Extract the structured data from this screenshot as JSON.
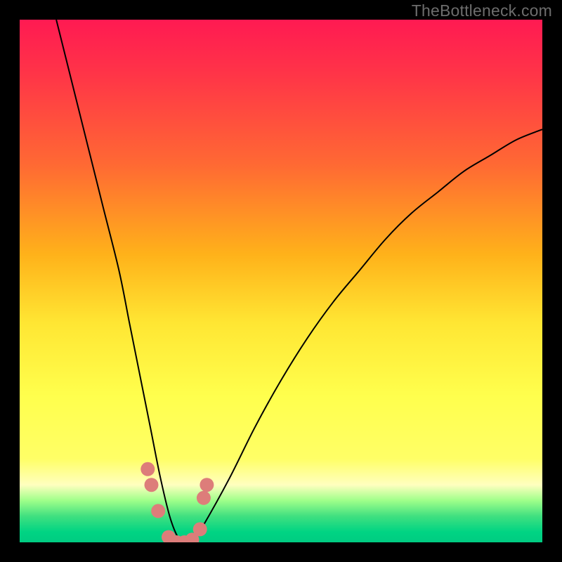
{
  "watermark": "TheBottleneck.com",
  "chart_data": {
    "type": "line",
    "title": "",
    "xlabel": "",
    "ylabel": "",
    "xlim": [
      0,
      100
    ],
    "ylim": [
      0,
      100
    ],
    "grid": false,
    "legend": false,
    "background_gradient": {
      "direction": "vertical",
      "stops": [
        {
          "pos": 0.0,
          "color": "#ff1a52"
        },
        {
          "pos": 0.1,
          "color": "#ff3348"
        },
        {
          "pos": 0.28,
          "color": "#ff6a33"
        },
        {
          "pos": 0.45,
          "color": "#ffb21a"
        },
        {
          "pos": 0.58,
          "color": "#ffe633"
        },
        {
          "pos": 0.72,
          "color": "#ffff4d"
        },
        {
          "pos": 0.84,
          "color": "#ffff66"
        },
        {
          "pos": 0.89,
          "color": "#ffffbf"
        },
        {
          "pos": 0.92,
          "color": "#9fff8a"
        },
        {
          "pos": 0.95,
          "color": "#40e080"
        },
        {
          "pos": 0.98,
          "color": "#00d483"
        },
        {
          "pos": 1.0,
          "color": "#00cc82"
        }
      ]
    },
    "series": [
      {
        "name": "bottleneck-curve",
        "color": "#000000",
        "x": [
          7,
          10,
          13,
          16,
          19,
          21,
          23,
          25,
          27,
          29,
          31,
          33,
          35,
          40,
          45,
          50,
          55,
          60,
          65,
          70,
          75,
          80,
          85,
          90,
          95,
          100
        ],
        "y": [
          100,
          88,
          76,
          64,
          52,
          42,
          32,
          22,
          12,
          4,
          0,
          0,
          3,
          12,
          22,
          31,
          39,
          46,
          52,
          58,
          63,
          67,
          71,
          74,
          77,
          79
        ]
      }
    ],
    "markers": [
      {
        "name": "pink-markers",
        "color": "#dd7d7a",
        "points": [
          {
            "x": 24.5,
            "y": 14.0
          },
          {
            "x": 25.2,
            "y": 11.0
          },
          {
            "x": 26.5,
            "y": 6.0
          },
          {
            "x": 28.5,
            "y": 1.0
          },
          {
            "x": 30.0,
            "y": 0.0
          },
          {
            "x": 31.5,
            "y": 0.0
          },
          {
            "x": 33.0,
            "y": 0.5
          },
          {
            "x": 34.5,
            "y": 2.5
          },
          {
            "x": 35.2,
            "y": 8.5
          },
          {
            "x": 35.8,
            "y": 11.0
          }
        ]
      }
    ]
  }
}
